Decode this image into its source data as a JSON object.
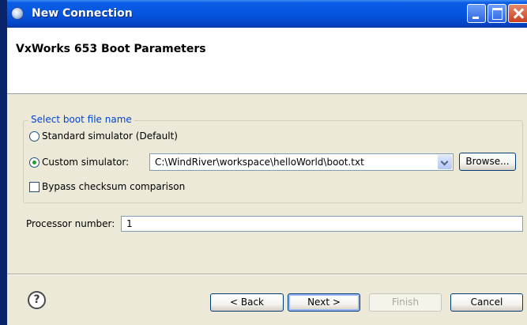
{
  "window": {
    "title": "New Connection"
  },
  "header": {
    "title": "VxWorks 653 Boot Parameters"
  },
  "boot_group": {
    "label": "Select boot file name",
    "standard_label": "Standard simulator (Default)",
    "custom_label": "Custom simulator:",
    "selected": "custom",
    "custom_path": "C:\\WindRiver\\workspace\\helloWorld\\boot.txt",
    "browse_label": "Browse...",
    "bypass_label": "Bypass checksum comparison",
    "bypass_checked": false
  },
  "processor": {
    "label": "Processor number:",
    "value": "1"
  },
  "buttons": {
    "back": "< Back",
    "next": "Next >",
    "finish": "Finish",
    "cancel": "Cancel"
  },
  "help_symbol": "?",
  "icons": {
    "help": "help-icon",
    "app": "app-icon",
    "dropdown": "chevron-down-icon"
  },
  "colors": {
    "title_bar": "#0655e0",
    "group_label": "#0046d5",
    "dialog_bg": "#ece9d8"
  }
}
